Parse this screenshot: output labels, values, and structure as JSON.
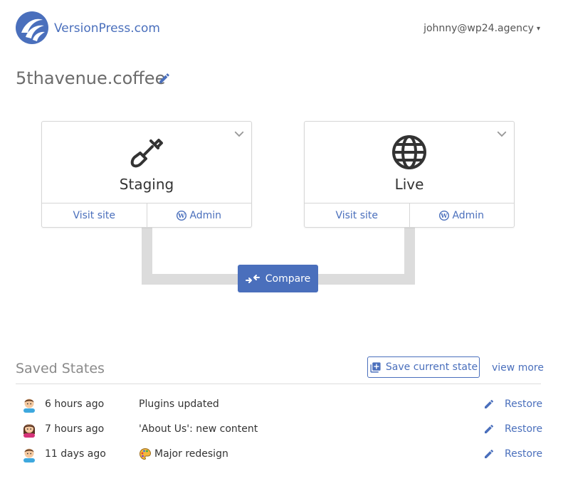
{
  "header": {
    "brand": "VersionPress.com",
    "user": "johnny@wp24.agency",
    "user_caret": "▾"
  },
  "site": {
    "title": "5thavenue.coffee"
  },
  "environments": [
    {
      "name": "Staging",
      "icon": "shovel-icon",
      "visit_label": "Visit site",
      "admin_label": "Admin"
    },
    {
      "name": "Live",
      "icon": "globe-icon",
      "visit_label": "Visit site",
      "admin_label": "Admin"
    }
  ],
  "compare": {
    "label": "Compare"
  },
  "saved_states": {
    "title": "Saved States",
    "save_label": "Save current state",
    "view_more_label": "view more",
    "rows": [
      {
        "avatar": "male-avatar",
        "time": "6 hours ago",
        "message": "Plugins updated",
        "message_icon": "",
        "restore_label": "Restore"
      },
      {
        "avatar": "female-avatar",
        "time": "7 hours ago",
        "message": "'About Us': new content",
        "message_icon": "",
        "restore_label": "Restore"
      },
      {
        "avatar": "male-avatar",
        "time": "11 days ago",
        "message": "Major redesign",
        "message_icon": "palette-emoji",
        "restore_label": "Restore"
      }
    ]
  },
  "colors": {
    "accent": "#4a6fbc",
    "pipe": "#dcdcdc",
    "border": "#d6d6d6"
  }
}
